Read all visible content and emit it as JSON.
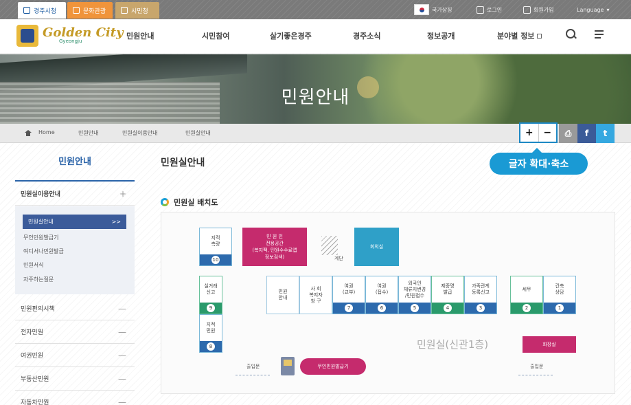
{
  "top_tabs": [
    "경주시청",
    "문화관광",
    "시민청"
  ],
  "top_util": {
    "portal": "국가상징",
    "login": "로그인",
    "join": "회원가입",
    "language": "Language"
  },
  "logo": {
    "name": "Golden City",
    "sub": "Gyeongju"
  },
  "nav": {
    "menu": [
      "민원안내",
      "시민참여",
      "살기좋은경주",
      "경주소식",
      "정보공개",
      "분야별 정보"
    ],
    "search_icon": "search-icon",
    "menu_icon": "menu-icon"
  },
  "hero": {
    "title": "민원안내"
  },
  "breadcrumb": [
    "Home",
    "민원안내",
    "민원실이용안내",
    "민원실안내"
  ],
  "zoom": {
    "plus": "+",
    "minus": "−"
  },
  "share": [
    "print-icon",
    "facebook-icon",
    "twitter-icon"
  ],
  "tooltip": "글자 확대·축소",
  "sidebar": {
    "title": "민원안내",
    "group_label": "민원실이용안내",
    "group_sign": "+",
    "active_item": "민원실안내",
    "active_mark": ">>",
    "sub_items": [
      "무인민원발급기",
      "여디서나민원발급",
      "민원서식",
      "자주하는질문"
    ],
    "other_items": [
      "민원편의시책",
      "전자민원",
      "여권민원",
      "부동산민원",
      "자동차민원"
    ],
    "other_sign": "—"
  },
  "main": {
    "page_title": "민원실안내",
    "section_title": "민원실 배치도"
  },
  "plan": {
    "top_blocks": {
      "jijeok_survey": "지적\n측량",
      "jijeok_num": "10",
      "pink_block": "민 원 인\n전용공간\n(복지팩, 민원수수료앱\n정보검색)",
      "stairs_label": "계단",
      "meeting_room": "회의실"
    },
    "left_column": [
      {
        "label": "실거래\n신고",
        "num": "9"
      },
      {
        "label": "지적\n민원",
        "num": "8"
      }
    ],
    "counter_center": [
      {
        "label": "민원\n안내",
        "num": ""
      },
      {
        "label": "사 회\n복지자\n창 구",
        "num": ""
      },
      {
        "label": "여권\n(교부)",
        "num": "7"
      },
      {
        "label": "여권\n(접수)",
        "num": "6"
      },
      {
        "label": "외국인\n체류지변경\n/민원접수",
        "num": "5"
      },
      {
        "label": "제증명\n발급",
        "num": "4"
      },
      {
        "label": "가족관계\n등록신고",
        "num": "3"
      }
    ],
    "counter_right": [
      {
        "label": "세무",
        "num": "2"
      },
      {
        "label": "건축\n상담",
        "num": "1"
      }
    ],
    "room_label": "민원실(신관1층)",
    "restroom": "화장실",
    "entrance_left": "출입문",
    "entrance_right": "출입문",
    "kiosk_pill": "무인민원발급기"
  },
  "colors": {
    "brand_blue": "#2a63a8",
    "tooltip_blue": "#1a9ad4",
    "pink": "#c52b6d",
    "teal": "#2fa0c8",
    "green": "#2a9a6b"
  }
}
